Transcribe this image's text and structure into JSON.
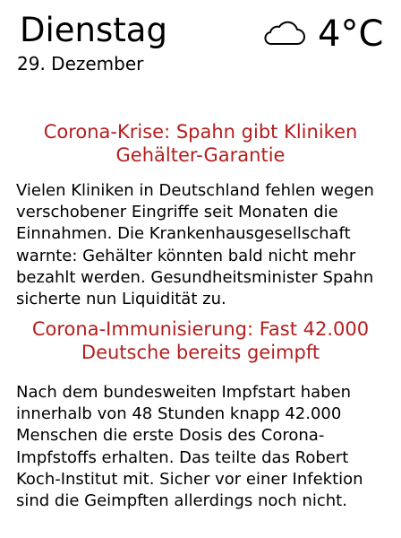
{
  "header": {
    "day": "Dienstag",
    "date": "29. Dezember",
    "weather_icon": "cloud-icon",
    "temperature": "4°C"
  },
  "colors": {
    "headline": "#b41e1e",
    "text": "#000000",
    "background": "#ffffff"
  },
  "news": [
    {
      "headline": "Corona-Krise: Spahn gibt Kliniken Gehälter-Garantie",
      "body": "Vielen Kliniken in Deutschland fehlen wegen verschobener Eingriffe seit Monaten die Einnahmen. Die Krankenhausgesellschaft warnte: Gehälter könnten bald nicht mehr bezahlt werden. Gesundheitsminister Spahn sicherte nun Liquidität zu."
    },
    {
      "headline": "Corona-Immunisierung: Fast 42.000 Deutsche bereits geimpft",
      "body": "Nach dem bundesweiten Impfstart haben innerhalb von 48 Stunden knapp 42.000 Menschen die erste Dosis des Corona-Impfstoffs erhalten. Das teilte das Robert Koch-Institut mit. Sicher vor einer Infektion sind die Geimpften allerdings noch nicht."
    }
  ]
}
